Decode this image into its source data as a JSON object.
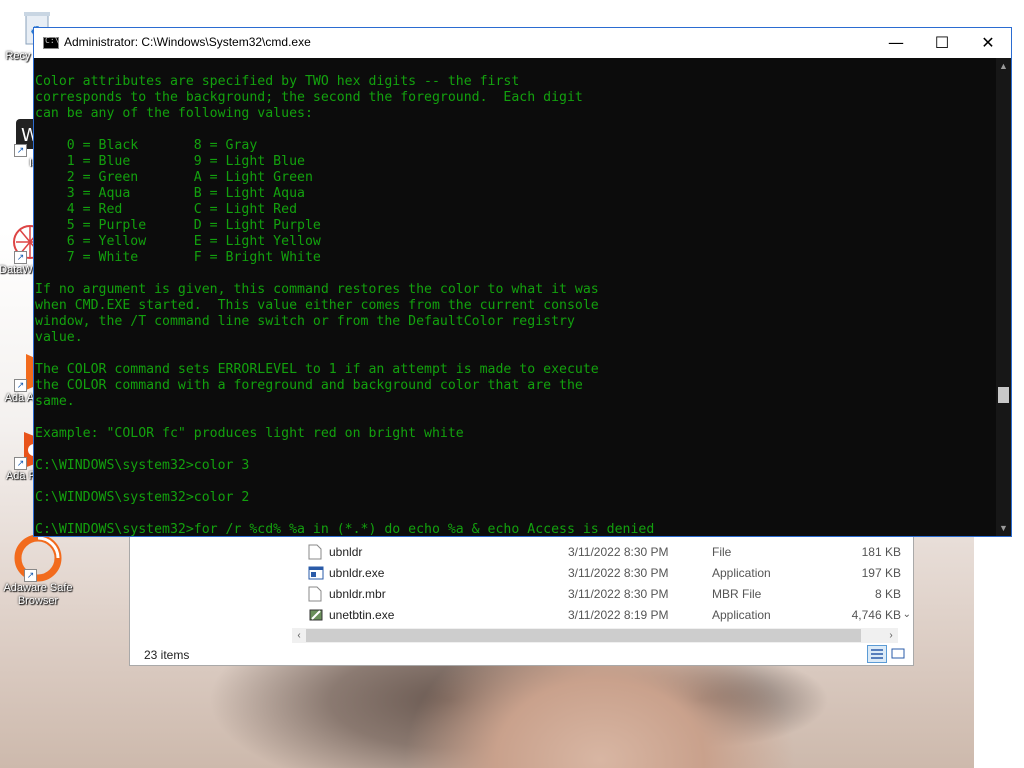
{
  "desktop": {
    "icons": [
      {
        "label": "Recy",
        "icon": "recycle-bin-icon"
      },
      {
        "label": "IJS",
        "icon": "app-shortcut-icon"
      },
      {
        "label": "DataW",
        "icon": "datawrapper-icon"
      },
      {
        "label": "Ada Ant",
        "icon": "adaware-antivirus-icon"
      },
      {
        "label": "Ada Pri",
        "icon": "adaware-privacy-icon"
      },
      {
        "label": "Adaware Safe Browser",
        "icon": "adaware-browser-icon"
      }
    ]
  },
  "explorer": {
    "files": [
      {
        "name": "ubnldr",
        "date": "3/11/2022 8:30 PM",
        "type": "File",
        "size": "181 KB",
        "icon": "file-icon"
      },
      {
        "name": "ubnldr.exe",
        "date": "3/11/2022 8:30 PM",
        "type": "Application",
        "size": "197 KB",
        "icon": "exe-icon"
      },
      {
        "name": "ubnldr.mbr",
        "date": "3/11/2022 8:30 PM",
        "type": "MBR File",
        "size": "8 KB",
        "icon": "file-icon"
      },
      {
        "name": "unetbtin.exe",
        "date": "3/11/2022 8:19 PM",
        "type": "Application",
        "size": "4,746 KB",
        "icon": "unetbootin-icon"
      }
    ],
    "status": "23 items"
  },
  "cmd": {
    "title": "Administrator: C:\\Windows\\System32\\cmd.exe",
    "controls": {
      "minimize": "—",
      "maximize": "☐",
      "close": "✕"
    },
    "text_color": "#13a10e",
    "lines": [
      "Color attributes are specified by TWO hex digits -- the first",
      "corresponds to the background; the second the foreground.  Each digit",
      "can be any of the following values:",
      "",
      "    0 = Black       8 = Gray",
      "    1 = Blue        9 = Light Blue",
      "    2 = Green       A = Light Green",
      "    3 = Aqua        B = Light Aqua",
      "    4 = Red         C = Light Red",
      "    5 = Purple      D = Light Purple",
      "    6 = Yellow      E = Light Yellow",
      "    7 = White       F = Bright White",
      "",
      "If no argument is given, this command restores the color to what it was",
      "when CMD.EXE started.  This value either comes from the current console",
      "window, the /T command line switch or from the DefaultColor registry",
      "value.",
      "",
      "The COLOR command sets ERRORLEVEL to 1 if an attempt is made to execute",
      "the COLOR command with a foreground and background color that are the",
      "same.",
      "",
      "Example: \"COLOR fc\" produces light red on bright white",
      "",
      "C:\\WINDOWS\\system32>color 3",
      "",
      "C:\\WINDOWS\\system32>color 2",
      "",
      "C:\\WINDOWS\\system32>for /r %cd% %a in (*.*) do echo %a & echo Access is denied"
    ]
  }
}
